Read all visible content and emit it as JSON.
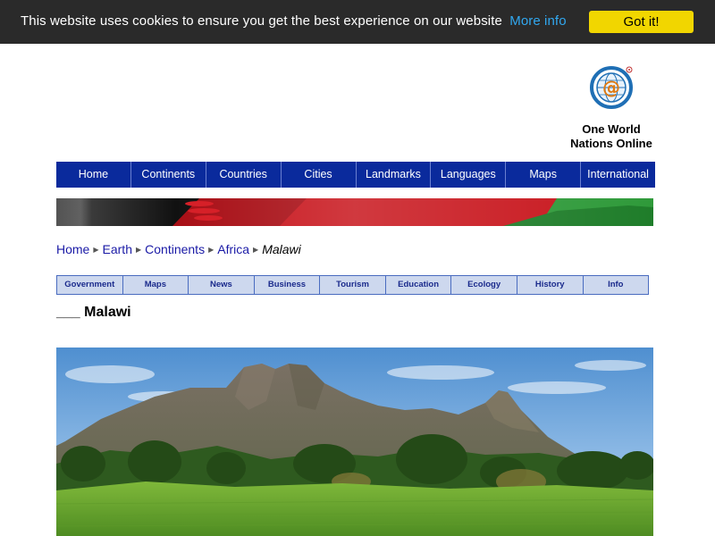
{
  "cookie_bar": {
    "message": "This website uses cookies to ensure you get the best experience on our website",
    "more_info": "More info",
    "button": "Got it!"
  },
  "site": {
    "name_line1": "One World",
    "name_line2": "Nations Online",
    "logo_icon": "at-globe-logo"
  },
  "main_nav": {
    "items": [
      "Home",
      "Continents",
      "Countries",
      "Cities",
      "Landmarks",
      "Languages",
      "Maps",
      "International"
    ]
  },
  "breadcrumb": {
    "items": [
      "Home",
      "Earth",
      "Continents",
      "Africa"
    ],
    "current": "Malawi"
  },
  "sub_nav": {
    "items": [
      "Government",
      "Maps",
      "News",
      "Business",
      "Tourism",
      "Education",
      "Ecology",
      "History",
      "Info"
    ]
  },
  "page": {
    "title": "___ Malawi"
  },
  "colors": {
    "cookie_bg": "#2a2a2a",
    "cookie_link": "#31a8f0",
    "cookie_button": "#f1d600",
    "nav_bg": "#0a2a9c",
    "subnav_bg": "#cdd8ee"
  }
}
